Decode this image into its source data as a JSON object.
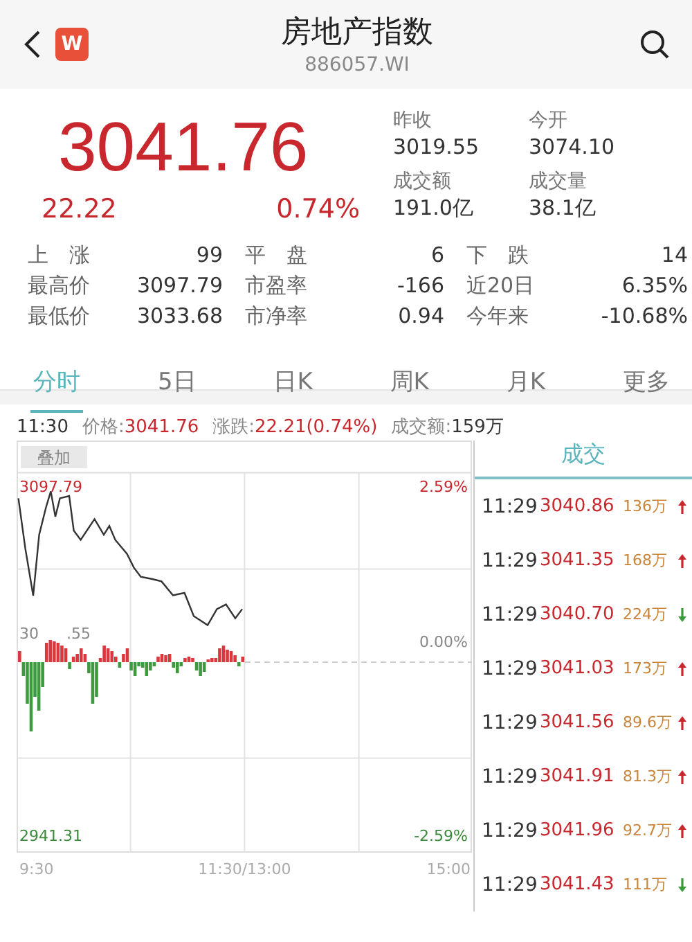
{
  "header": {
    "title": "房地产指数",
    "code": "886057.WI",
    "logo": "W"
  },
  "quote": {
    "price": "3041.76",
    "change": "22.22",
    "change_pct": "0.74%"
  },
  "summary": [
    {
      "label": "昨收",
      "value": "3019.55"
    },
    {
      "label": "今开",
      "value": "3074.10"
    },
    {
      "label": "成交额",
      "value": "191.0亿"
    },
    {
      "label": "成交量",
      "value": "38.1亿"
    }
  ],
  "stats": [
    {
      "label": "上 涨",
      "value": "99"
    },
    {
      "label": "平 盘",
      "value": "6"
    },
    {
      "label": "下 跌",
      "value": "14"
    },
    {
      "label": "最高价",
      "value": "3097.79"
    },
    {
      "label": "市盈率",
      "value": "-166"
    },
    {
      "label": "近20日",
      "value": "6.35%"
    },
    {
      "label": "最低价",
      "value": "3033.68"
    },
    {
      "label": "市净率",
      "value": "0.94"
    },
    {
      "label": "今年来",
      "value": "-10.68%"
    }
  ],
  "tabs": [
    {
      "label": "分时",
      "selected": true
    },
    {
      "label": "5日",
      "selected": false
    },
    {
      "label": "日K",
      "selected": false
    },
    {
      "label": "周K",
      "selected": false
    },
    {
      "label": "月K",
      "selected": false
    },
    {
      "label": "更多",
      "selected": false
    }
  ],
  "chart_info": {
    "time": "11:30",
    "price_label": "价格:",
    "price": "3041.76",
    "change_label": "涨跌:",
    "change": "22.21(0.74%)",
    "volume_label": "成交额:",
    "volume": "159万"
  },
  "chart": {
    "overlay_button": "叠加",
    "high": "3097.79",
    "prev_close_start": "30",
    "prev_close_end": ".55",
    "low": "2941.31",
    "top_pct": "2.59%",
    "zero_pct": "0.00%",
    "bottom_pct": "-2.59%",
    "time_labels": [
      "9:30",
      "11:30/13:00",
      "15:00"
    ]
  },
  "trades": {
    "title": "成交",
    "rows": [
      {
        "time": "11:29",
        "price": "3040.86",
        "volume": "136万",
        "up": true
      },
      {
        "time": "11:29",
        "price": "3041.35",
        "volume": "168万",
        "up": true
      },
      {
        "time": "11:29",
        "price": "3040.70",
        "volume": "224万",
        "up": false
      },
      {
        "time": "11:29",
        "price": "3041.03",
        "volume": "173万",
        "up": true
      },
      {
        "time": "11:29",
        "price": "3041.56",
        "volume": "89.6万",
        "up": true
      },
      {
        "time": "11:29",
        "price": "3041.91",
        "volume": "81.3万",
        "up": true
      },
      {
        "time": "11:29",
        "price": "3041.96",
        "volume": "92.7万",
        "up": true
      },
      {
        "time": "11:29",
        "price": "3041.43",
        "volume": "111万",
        "up": false
      }
    ]
  }
}
